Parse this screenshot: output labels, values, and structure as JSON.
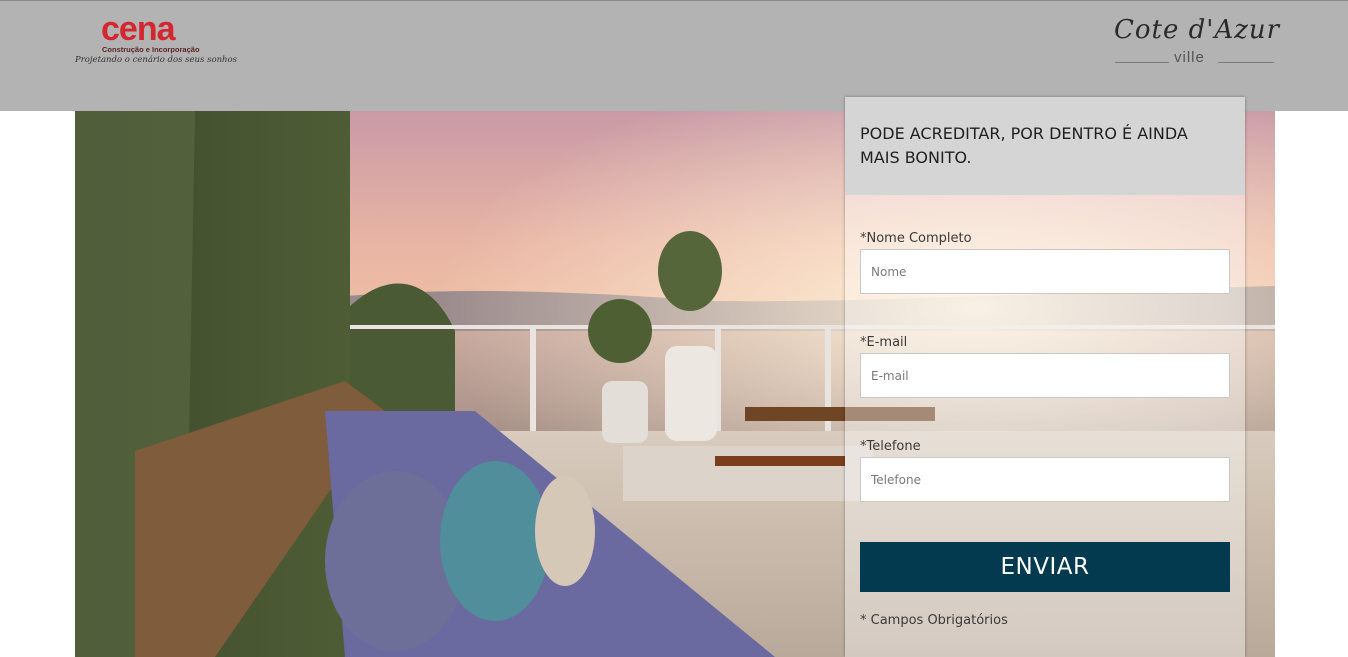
{
  "header": {
    "logo_left": {
      "brand": "cena",
      "subtitle": "Construção e Incorporação",
      "tagline": "Projetando o cenário dos seus sonhos"
    },
    "logo_right": {
      "script": "Cote d'Azur",
      "ville": "ville"
    },
    "background_color": "#b3b3b3"
  },
  "hero": {
    "image_description_icon": "terrace-sunset-photo"
  },
  "form": {
    "title": "PODE ACREDITAR, POR DENTRO É AINDA MAIS BONITO.",
    "fields": [
      {
        "label": "*Nome Completo",
        "placeholder": "Nome",
        "value": ""
      },
      {
        "label": "*E-mail",
        "placeholder": "E-mail",
        "value": ""
      },
      {
        "label": "*Telefone",
        "placeholder": "Telefone",
        "value": ""
      }
    ],
    "submit_label": "ENVIAR",
    "required_note": "* Campos Obrigatórios",
    "button_color": "#033a4f",
    "header_color": "#d5d5d5"
  }
}
